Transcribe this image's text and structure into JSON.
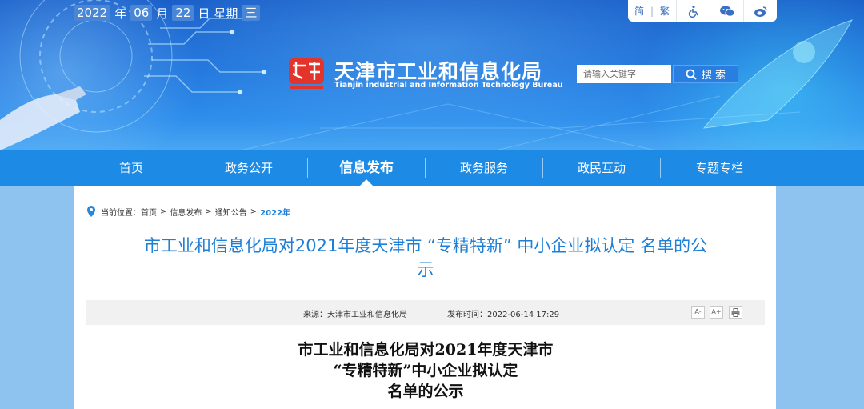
{
  "header": {
    "date": {
      "year": "2022",
      "year_unit": "年",
      "month": "06",
      "month_unit": "月",
      "day": "22",
      "day_unit": "日",
      "weekday_label": "星期",
      "weekday": "三"
    },
    "tools": {
      "lang_simplified": "简",
      "lang_separator": "|",
      "lang_traditional": "繁",
      "accessibility_icon": "wheelchair-icon",
      "wechat_icon": "wechat-icon",
      "weibo_icon": "weibo-icon"
    },
    "site_title": "天津市工业和信息化局",
    "site_subtitle": "Tianjin industrial and Information Technology Bureau",
    "search": {
      "placeholder": "请输入关键字",
      "button_label": "搜 索"
    },
    "colors": {
      "banner": "#1f73db",
      "nav": "#1d8be6",
      "accent": "#1e7fd6"
    }
  },
  "nav": {
    "items": [
      {
        "label": "首页"
      },
      {
        "label": "政务公开"
      },
      {
        "label": "信息发布",
        "active": true
      },
      {
        "label": "政务服务"
      },
      {
        "label": "政民互动"
      },
      {
        "label": "专题专栏"
      }
    ]
  },
  "breadcrumb": {
    "prefix": "当前位置：",
    "items": [
      "首页",
      "信息发布",
      "通知公告",
      "2022年"
    ],
    "separator": ">"
  },
  "article": {
    "title_line1": "市工业和信息化局对2021年度天津市 “专精特新” 中小企业拟认定 名单的公",
    "title_line2": "示",
    "source": "来源：天津市工业和信息化局",
    "published": "发布时间：2022-06-14 17:29",
    "font_increase": "A+",
    "font_decrease": "A-",
    "print_icon": "printer-icon",
    "doc_title_line1": "市工业和信息化局对2021年度天津市",
    "doc_title_line2": "“专精特新”中小企业拟认定",
    "doc_title_line3": "名单的公示"
  }
}
